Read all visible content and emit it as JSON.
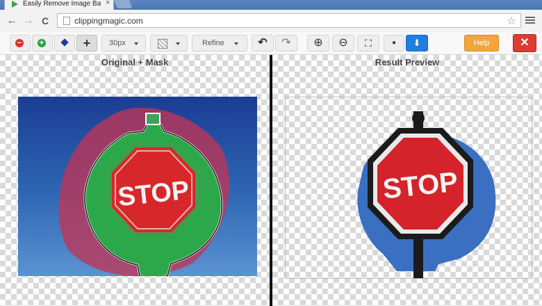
{
  "browser": {
    "tab_title": "Easily Remove Image Bac",
    "tab_close_glyph": "×",
    "url": "clippingmagic.com",
    "back_glyph": "←",
    "forward_glyph": "→",
    "reload_glyph": "C",
    "star_glyph": "☆"
  },
  "toolbar": {
    "remove_glyph": "−",
    "keep_glyph": "+",
    "brush_size": "30px",
    "refine_label": "Refine",
    "undo_glyph": "↶",
    "redo_glyph": "↷",
    "zoom_in_glyph": "⊕",
    "zoom_out_glyph": "⊖",
    "fit_glyph": "⛶",
    "save_glyph": "▪",
    "download_glyph": "⬇",
    "help_label": "Help",
    "close_glyph": "✕"
  },
  "panes": {
    "left_title": "Original + Mask",
    "right_title": "Result Preview"
  },
  "sign_text": "STOP",
  "colors": {
    "remove_red": "#d9322b",
    "keep_green": "#2ea043",
    "download_blue": "#1f7fe0",
    "help_orange": "#f3a53a",
    "close_red": "#dd3c33"
  },
  "icons": {
    "brush": "diamond-brush-icon",
    "move": "plus-move-icon",
    "background": "checkerboard-icon"
  }
}
